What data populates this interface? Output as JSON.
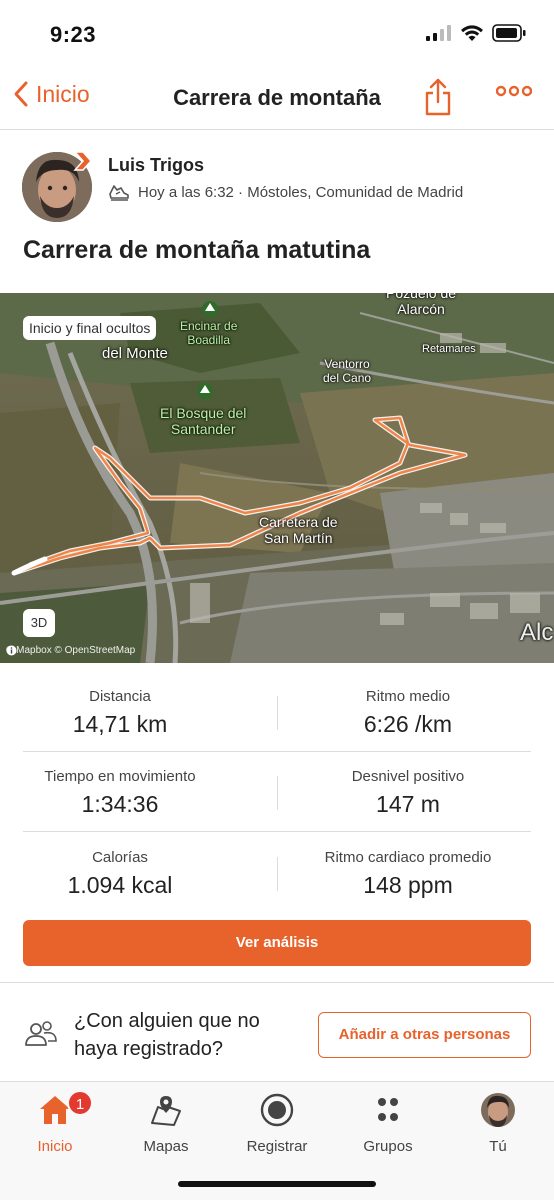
{
  "status_bar": {
    "time": "9:23"
  },
  "nav": {
    "back_label": "Inicio",
    "title": "Carrera de montaña"
  },
  "athlete": {
    "name": "Luis Trigos",
    "meta": "Hoy a las 6:32 · Móstoles, Comunidad de Madrid"
  },
  "activity": {
    "title": "Carrera de montaña matutina"
  },
  "map": {
    "privacy_chip": "Inicio y final ocultos",
    "view_3d": "3D",
    "attribution": "© Mapbox © OpenStreetMap",
    "labels": {
      "pozuelo": "Pozuelo de\nAlarcón",
      "encinar": "Encinar de\nBoadilla",
      "del_monte": "del Monte",
      "retamares": "Retamares",
      "ventorro": "Ventorro\ndel Cano",
      "bosque": "El Bosque del\nSantander",
      "carretera": "Carretera de\nSan Martín",
      "alc": "Alc"
    }
  },
  "stats": [
    {
      "label": "Distancia",
      "value": "14,71 km"
    },
    {
      "label": "Ritmo medio",
      "value": "6:26 /km"
    },
    {
      "label": "Tiempo en movimiento",
      "value": "1:34:36"
    },
    {
      "label": "Desnivel positivo",
      "value": "147 m"
    },
    {
      "label": "Calorías",
      "value": "1.094 kcal"
    },
    {
      "label": "Ritmo cardiaco promedio",
      "value": "148 ppm"
    }
  ],
  "analysis_button": "Ver análisis",
  "invite": {
    "text": "¿Con alguien que no haya registrado?",
    "button": "Añadir a otras personas"
  },
  "tabs": [
    {
      "label": "Inicio",
      "icon": "home-icon",
      "badge": "1"
    },
    {
      "label": "Mapas",
      "icon": "map-icon"
    },
    {
      "label": "Registrar",
      "icon": "record-icon"
    },
    {
      "label": "Grupos",
      "icon": "groups-icon"
    },
    {
      "label": "Tú",
      "icon": "avatar"
    }
  ],
  "colors": {
    "accent": "#e8622c",
    "badge": "#e23a2e"
  }
}
